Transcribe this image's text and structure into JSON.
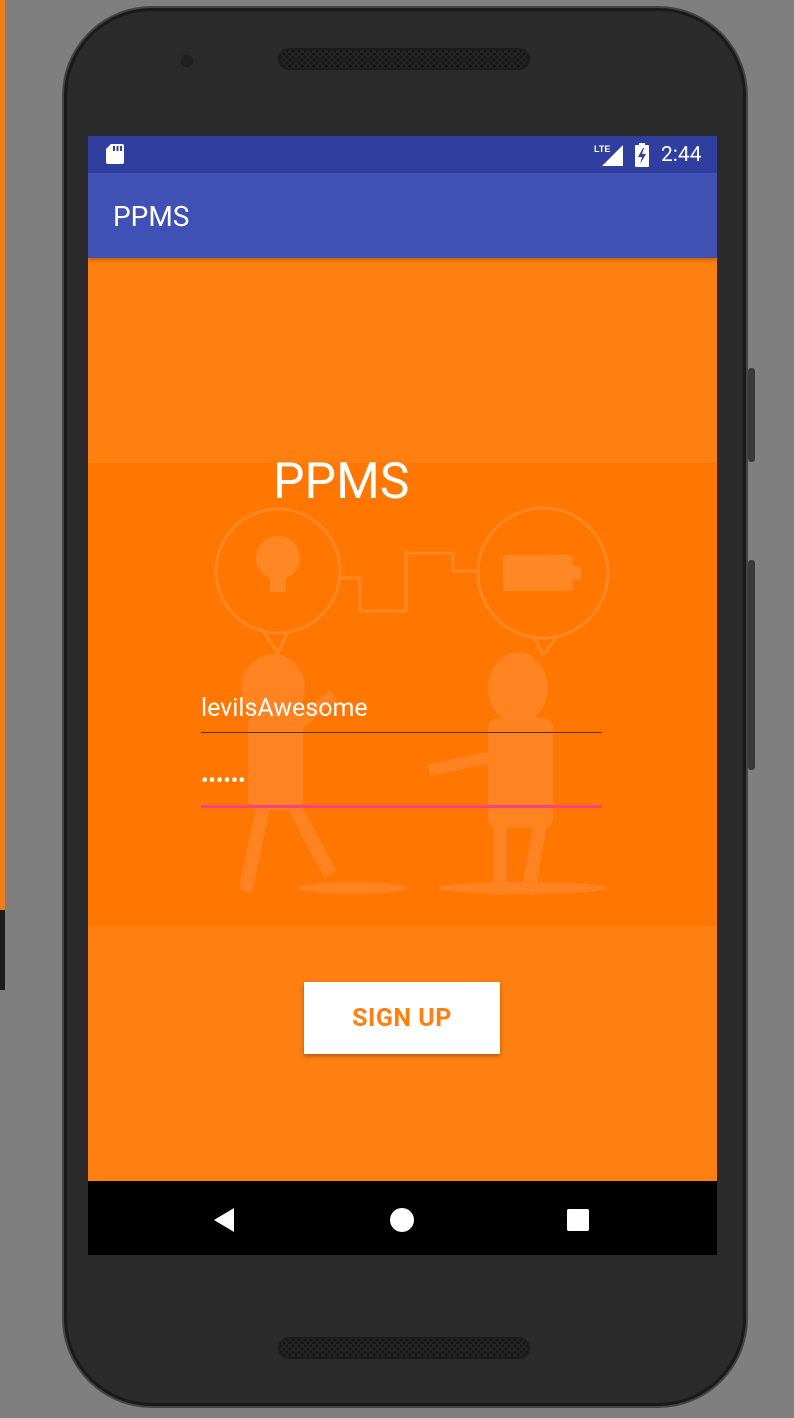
{
  "status_bar": {
    "time": "2:44",
    "network_label": "LTE",
    "icons": [
      "sd-card-icon",
      "lte-signal-icon",
      "battery-charging-icon"
    ]
  },
  "app_bar": {
    "title": "PPMS"
  },
  "main": {
    "heading": "PPMS",
    "username_value": "levilsAwesome",
    "password_value": "••••••",
    "signup_label": "SIGN UP"
  },
  "nav_bar": {
    "icons": [
      "back-icon",
      "home-icon",
      "recents-icon"
    ]
  },
  "colors": {
    "background_orange": "#ff7f11",
    "hero_orange": "#ff7600",
    "status_bar": "#303f9f",
    "app_bar": "#3f51b5",
    "accent_pink": "#ff4081"
  }
}
